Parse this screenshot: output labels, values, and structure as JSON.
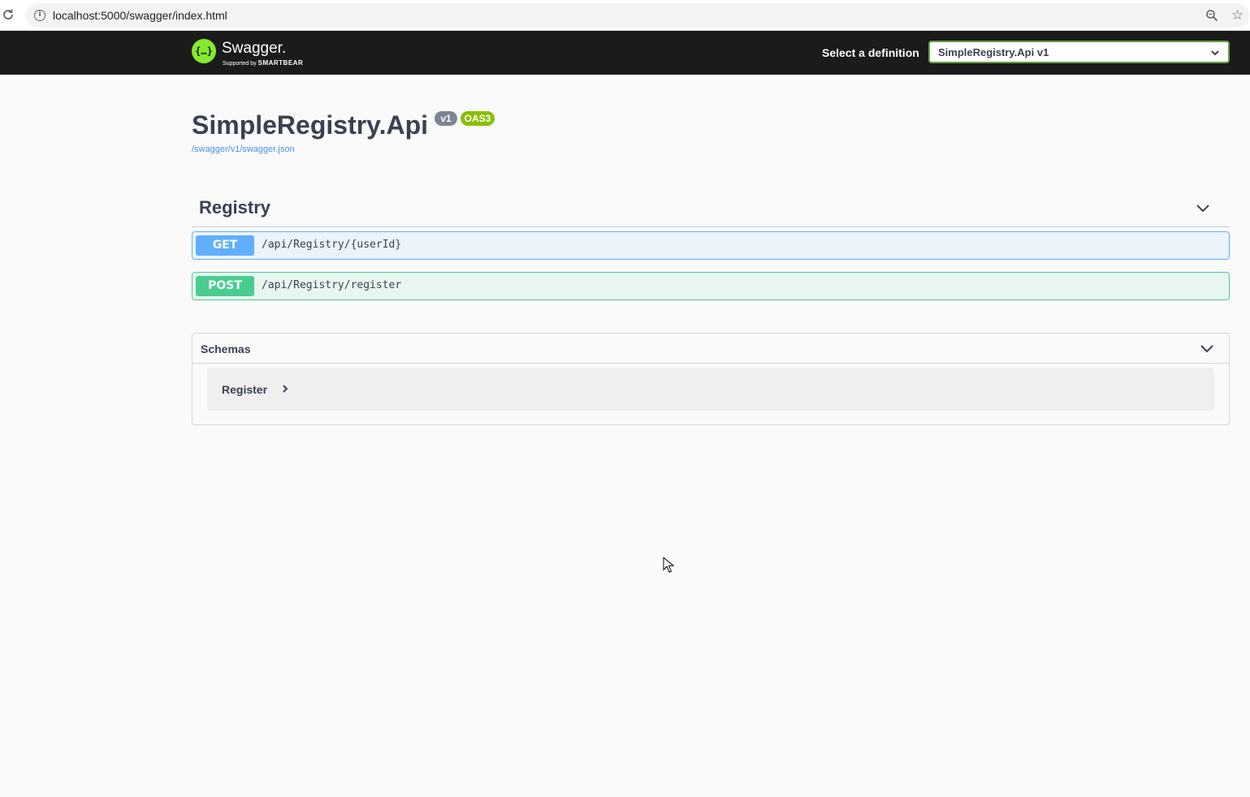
{
  "browser": {
    "url": "localhost:5000/swagger/index.html",
    "info_glyph": "i"
  },
  "topbar": {
    "logo_glyph": "{…}",
    "logo_title": "Swagger.",
    "logo_supported": "Supported by",
    "logo_brand": "SMARTBEAR",
    "definition_label": "Select a definition",
    "definition_selected": "SimpleRegistry.Api v1"
  },
  "info": {
    "title": "SimpleRegistry.Api",
    "version_badge": "v1",
    "oas_badge": "OAS3",
    "spec_link": "/swagger/v1/swagger.json"
  },
  "tag": {
    "name": "Registry",
    "operations": [
      {
        "method": "GET",
        "path": "/api/Registry/{userId}"
      },
      {
        "method": "POST",
        "path": "/api/Registry/register"
      }
    ]
  },
  "schemas": {
    "title": "Schemas",
    "models": [
      {
        "name": "Register"
      }
    ]
  },
  "colors": {
    "get": "#61affe",
    "post": "#49cc90",
    "topbar": "#1b1b1b",
    "logo": "#85ea2d",
    "oas": "#89bf04"
  },
  "icons": {
    "reload": "reload-icon",
    "info": "info-icon",
    "zoom": "zoom-icon",
    "star": "star-icon",
    "chevron_down": "chevron-down-icon",
    "chevron_right": "chevron-right-icon"
  }
}
